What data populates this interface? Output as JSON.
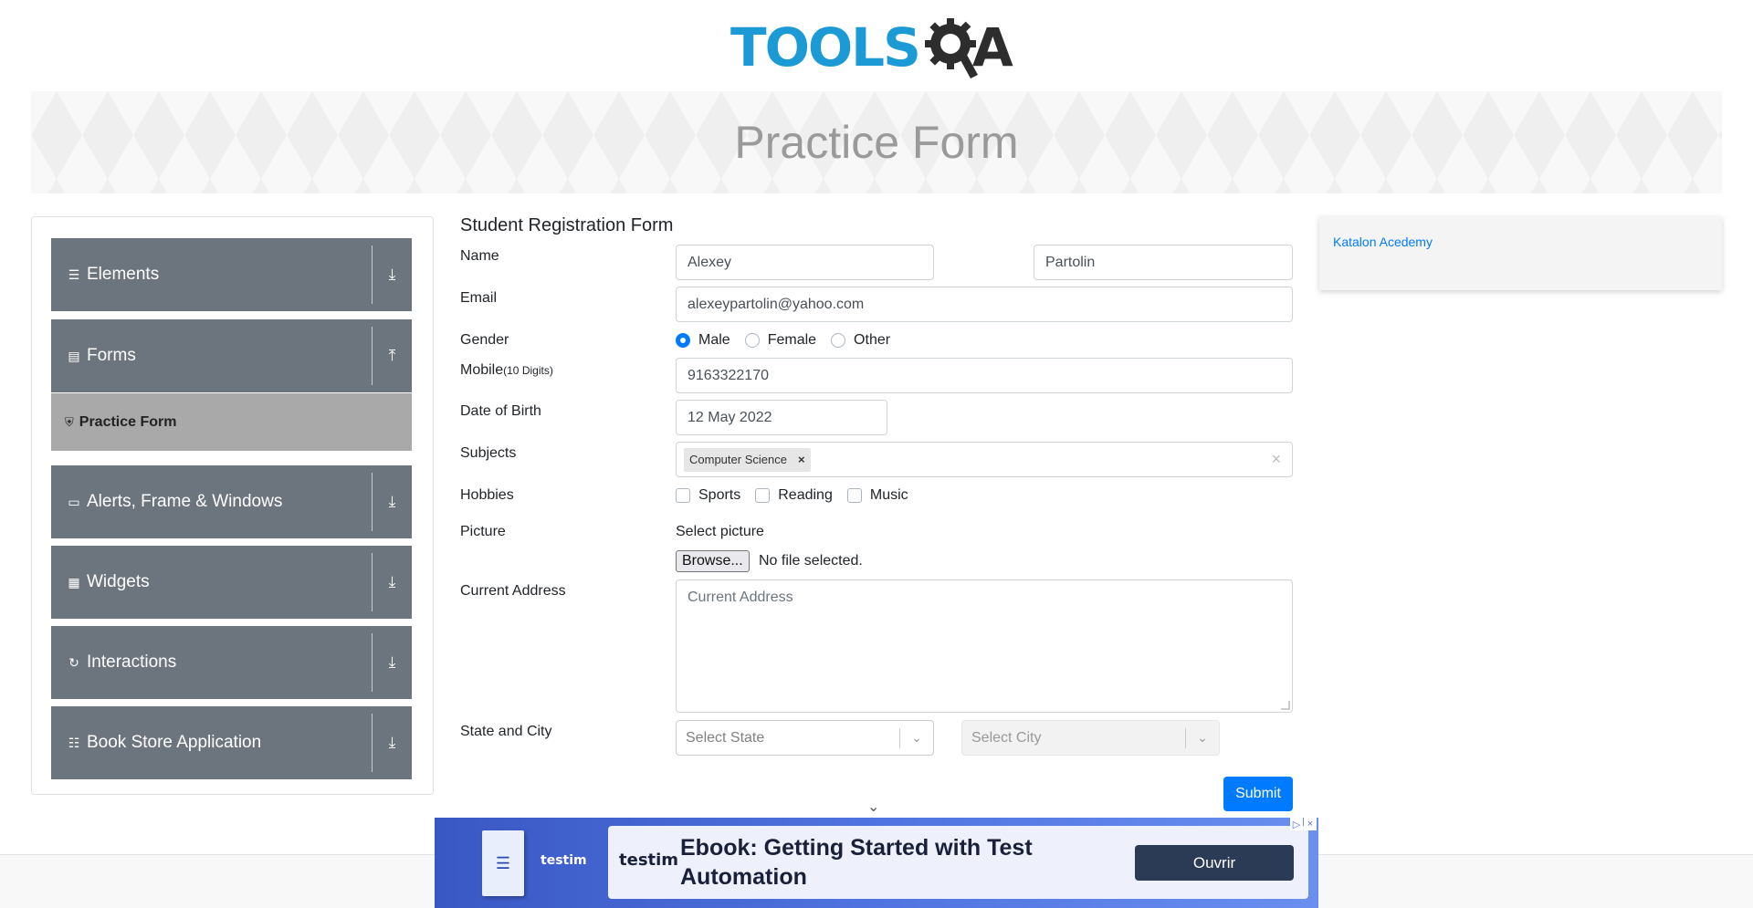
{
  "header": {
    "logo_text_main": "TOOLS",
    "logo_text_end": "A",
    "banner_title": "Practice Form"
  },
  "sidebar": {
    "groups": [
      {
        "label": "Elements",
        "icon": "list-icon",
        "arrow": "download-icon"
      },
      {
        "label": "Forms",
        "icon": "document-icon",
        "arrow": "upload-icon"
      },
      {
        "label": "Alerts, Frame & Windows",
        "icon": "window-icon",
        "arrow": "download-icon"
      },
      {
        "label": "Widgets",
        "icon": "widgets-icon",
        "arrow": "download-icon"
      },
      {
        "label": "Interactions",
        "icon": "interactions-icon",
        "arrow": "download-icon"
      },
      {
        "label": "Book Store Application",
        "icon": "books-icon",
        "arrow": "download-icon"
      }
    ],
    "active_item": {
      "label": "Practice Form",
      "icon": "shield-icon"
    }
  },
  "form": {
    "title": "Student Registration Form",
    "labels": {
      "name": "Name",
      "email": "Email",
      "gender": "Gender",
      "mobile": "Mobile",
      "mobile_hint": "(10 Digits)",
      "dob": "Date of Birth",
      "subjects": "Subjects",
      "hobbies": "Hobbies",
      "picture": "Picture",
      "address": "Current Address",
      "state_city": "State and City"
    },
    "first_name": "Alexey",
    "last_name": "Partolin",
    "email": "alexeypartolin@yahoo.com",
    "gender_options": [
      "Male",
      "Female",
      "Other"
    ],
    "gender_selected": "Male",
    "mobile": "9163322170",
    "dob": "12 May 2022",
    "subjects": [
      "Computer Science"
    ],
    "hobbies": [
      "Sports",
      "Reading",
      "Music"
    ],
    "picture_label": "Select picture",
    "browse_label": "Browse...",
    "no_file": "No file selected.",
    "address_placeholder": "Current Address",
    "state_placeholder": "Select State",
    "city_placeholder": "Select City",
    "submit_label": "Submit"
  },
  "right_ad": {
    "link": "Katalon Acedemy"
  },
  "bottom_ad": {
    "brand": "testim",
    "headline": "Ebook: Getting Started with Test Automation",
    "cta": "Ouvrir"
  },
  "colors": {
    "brand_blue": "#1c9ad6",
    "sidebar_gray": "#6c757d",
    "active_gray": "#a9a9a9",
    "primary": "#007bff"
  }
}
